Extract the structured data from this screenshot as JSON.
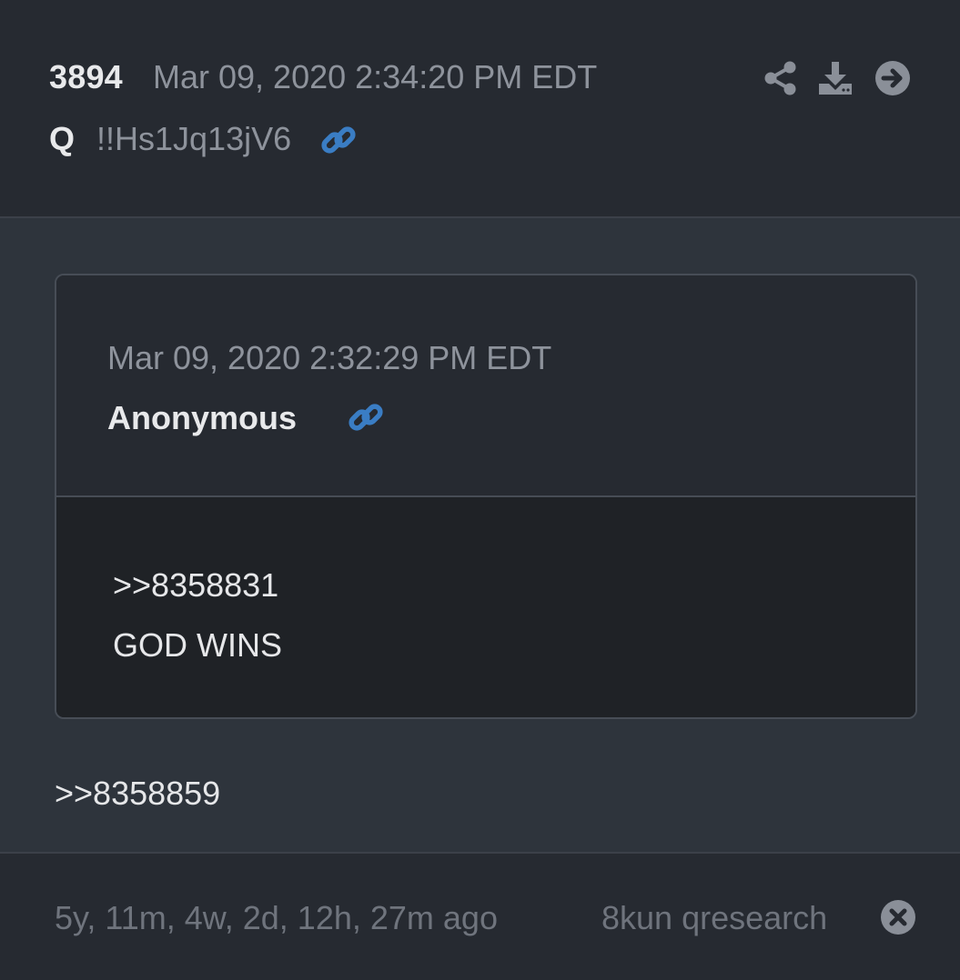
{
  "header": {
    "post_number": "3894",
    "date": "Mar 09, 2020 2:34:20 PM EDT",
    "author": "Q",
    "tripcode": "!!Hs1Jq13jV6",
    "actions": [
      "share-icon",
      "download-icon",
      "arrow-right-circle-icon"
    ]
  },
  "quote": {
    "date": "Mar 09, 2020 2:32:29 PM EDT",
    "author": "Anonymous",
    "lines": [
      ">>8358831",
      "GOD WINS"
    ]
  },
  "body": {
    "reply_ref": ">>8358859"
  },
  "footer": {
    "relative_time": "5y, 11m, 4w, 2d, 12h, 27m ago",
    "source": "8kun qresearch",
    "close_icon": "close-circle-icon"
  },
  "colors": {
    "background": "#262a31",
    "body_background": "#2e343c",
    "quote_content_background": "#1f2226",
    "link_blue": "#3a7dc4",
    "muted_text": "#8e939c",
    "icon_gray": "#8a8f98"
  }
}
